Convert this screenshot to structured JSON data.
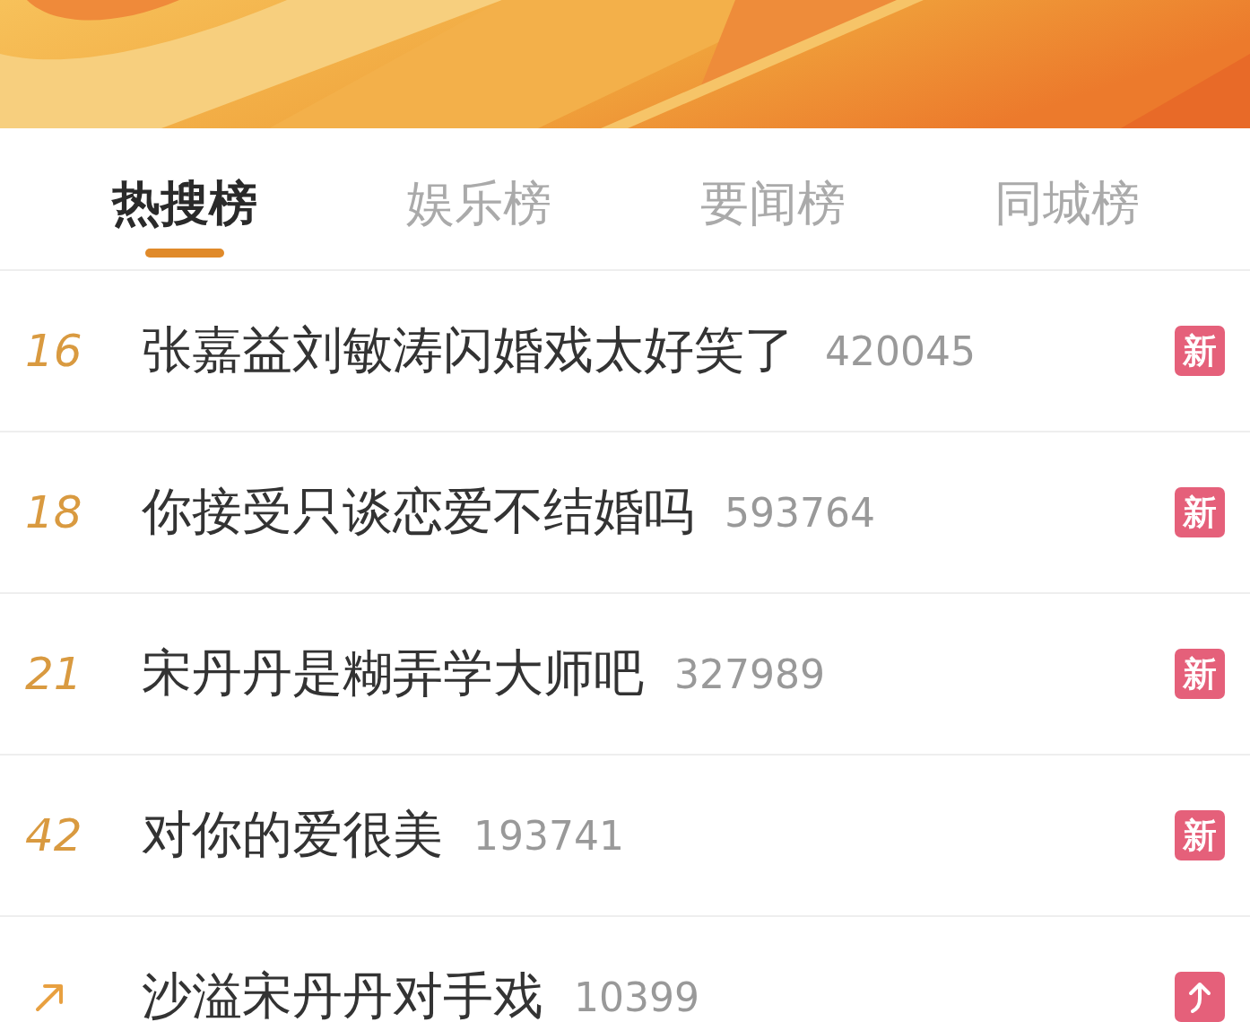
{
  "tabs": [
    {
      "label": "热搜榜",
      "selected": true
    },
    {
      "label": "娱乐榜",
      "selected": false
    },
    {
      "label": "要闻榜",
      "selected": false
    },
    {
      "label": "同城榜",
      "selected": false
    }
  ],
  "items": [
    {
      "kind": "ranked",
      "rank": "16",
      "title": "张嘉益刘敏涛闪婚戏太好笑了",
      "count": "420045",
      "badge": {
        "kind": "new",
        "label": "新"
      }
    },
    {
      "kind": "ranked",
      "rank": "18",
      "title": "你接受只谈恋爱不结婚吗",
      "count": "593764",
      "badge": {
        "kind": "new",
        "label": "新"
      }
    },
    {
      "kind": "ranked",
      "rank": "21",
      "title": "宋丹丹是糊弄学大师吧",
      "count": "327989",
      "badge": {
        "kind": "new",
        "label": "新"
      }
    },
    {
      "kind": "ranked",
      "rank": "42",
      "title": "对你的爱很美",
      "count": "193741",
      "badge": {
        "kind": "new",
        "label": "新"
      }
    },
    {
      "kind": "rising",
      "title": "沙溢宋丹丹对手戏",
      "count": "10399",
      "badge": {
        "kind": "rising"
      }
    }
  ]
}
